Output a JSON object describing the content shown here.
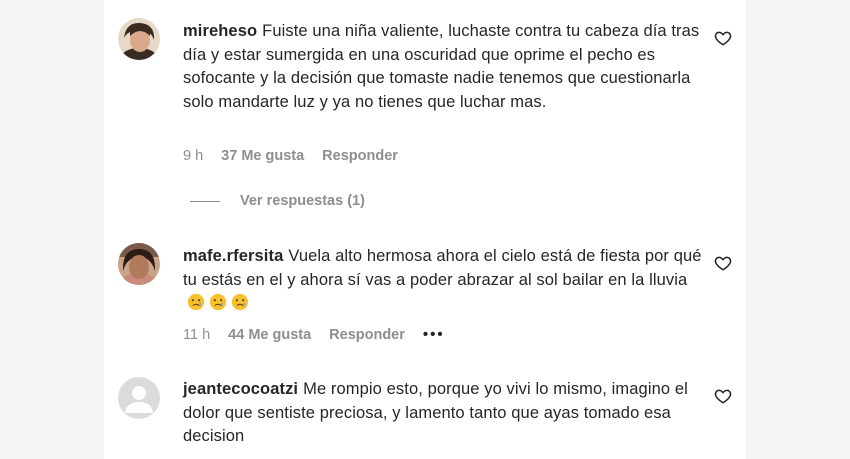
{
  "comments": [
    {
      "username": "mireheso",
      "text": "Fuiste una niña valiente, luchaste contra tu cabeza día tras día y estar sumergida en una oscuridad que oprime el pecho es sofocante y la decisión que tomaste nadie tenemos que cuestionarla solo mandarte luz y ya no tienes que luchar mas.",
      "time": "9 h",
      "likes": "37 Me gusta",
      "reply": "Responder",
      "view_replies": "Ver respuestas (1)"
    },
    {
      "username": "mafe.rfersita",
      "text": "Vuela alto hermosa ahora el cielo está de fiesta por qué tu estás en el y ahora sí vas a poder abrazar al sol bailar en la lluvia",
      "emojis": [
        "crying-face",
        "crying-face",
        "crying-face"
      ],
      "time": "11 h",
      "likes": "44 Me gusta",
      "reply": "Responder",
      "more": "•••"
    },
    {
      "username": "jeantecocoatzi",
      "text": "Me rompio esto, porque yo vivi lo mismo, imagino el dolor que sentiste preciosa, y lamento tanto que ayas tomado esa decision"
    }
  ],
  "icons": {
    "like": "heart-outline-icon",
    "more": "more-options-icon"
  },
  "colors": {
    "text": "#262626",
    "secondary": "#8e8e8e",
    "background": "#ffffff",
    "page": "#f5f5f5"
  }
}
